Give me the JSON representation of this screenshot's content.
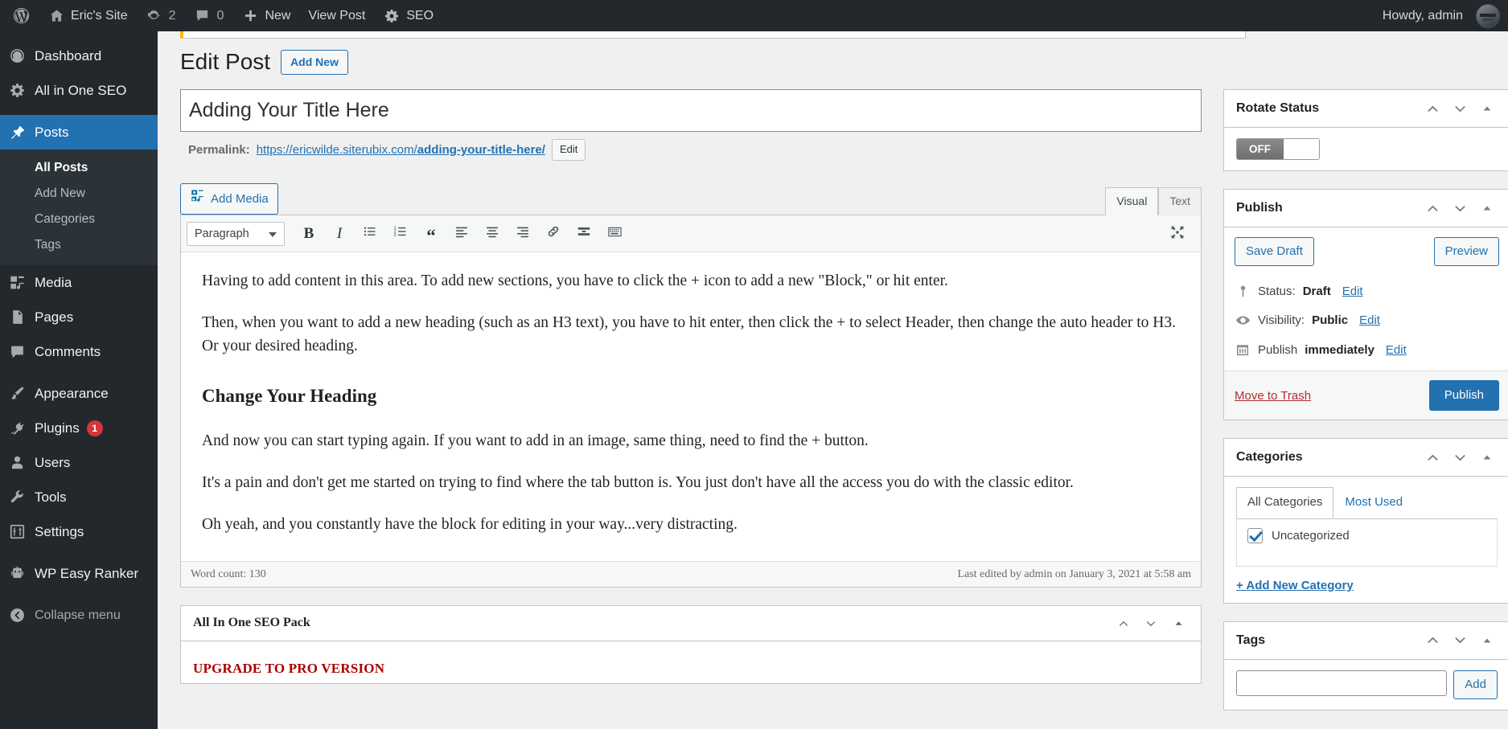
{
  "adminbar": {
    "wp_logo": "wordpress-logo-icon",
    "site_name": "Eric's Site",
    "updates_count": "2",
    "comments_count": "0",
    "new_label": "New",
    "view_post_label": "View Post",
    "seo_label": "SEO",
    "howdy": "Howdy, admin"
  },
  "sidebar": {
    "items": [
      {
        "label": "Dashboard",
        "icon": "dashboard-icon",
        "current": false
      },
      {
        "label": "All in One SEO",
        "icon": "aioseo-gear-icon",
        "current": false
      },
      {
        "label": "Posts",
        "icon": "pin-icon",
        "current": true
      },
      {
        "label": "Media",
        "icon": "media-icon",
        "current": false
      },
      {
        "label": "Pages",
        "icon": "pages-icon",
        "current": false
      },
      {
        "label": "Comments",
        "icon": "comment-icon",
        "current": false
      },
      {
        "label": "Appearance",
        "icon": "brush-icon",
        "current": false
      },
      {
        "label": "Plugins",
        "icon": "plug-icon",
        "current": false,
        "badge": "1"
      },
      {
        "label": "Users",
        "icon": "user-icon",
        "current": false
      },
      {
        "label": "Tools",
        "icon": "wrench-icon",
        "current": false
      },
      {
        "label": "Settings",
        "icon": "sliders-icon",
        "current": false
      },
      {
        "label": "WP Easy Ranker",
        "icon": "robot-icon",
        "current": false
      }
    ],
    "posts_submenu": [
      {
        "label": "All Posts",
        "current": true
      },
      {
        "label": "Add New",
        "current": false
      },
      {
        "label": "Categories",
        "current": false
      },
      {
        "label": "Tags",
        "current": false
      }
    ],
    "collapse_label": "Collapse menu",
    "collapse_icon": "collapse-arrow-icon"
  },
  "page": {
    "title": "Edit Post",
    "add_new_label": "Add New"
  },
  "title_field": {
    "value": "Adding Your Title Here",
    "placeholder": "Add title"
  },
  "permalink": {
    "label": "Permalink:",
    "url_prefix": "https://ericwilde.siterubix.com/",
    "slug": "adding-your-title-here/",
    "edit_label": "Edit"
  },
  "editor": {
    "add_media_label": "Add Media",
    "add_media_icon": "media-add-icon",
    "tabs": [
      {
        "label": "Visual",
        "active": true
      },
      {
        "label": "Text",
        "active": false
      }
    ],
    "format_select": "Paragraph",
    "toolbar_buttons": [
      {
        "name": "bold-icon",
        "label": "B"
      },
      {
        "name": "italic-icon",
        "label": "I"
      },
      {
        "name": "bulleted-list-icon",
        "label": ""
      },
      {
        "name": "numbered-list-icon",
        "label": ""
      },
      {
        "name": "blockquote-icon",
        "label": ""
      },
      {
        "name": "align-left-icon",
        "label": ""
      },
      {
        "name": "align-center-icon",
        "label": ""
      },
      {
        "name": "align-right-icon",
        "label": ""
      },
      {
        "name": "insert-link-icon",
        "label": ""
      },
      {
        "name": "read-more-icon",
        "label": ""
      },
      {
        "name": "toolbar-toggle-icon",
        "label": ""
      }
    ],
    "fullscreen_icon": "distraction-free-icon",
    "content": {
      "paragraph_1": "Having to add content in this area. To add new sections, you have to click the + icon to add a new \"Block,\" or hit enter.",
      "paragraph_2": "Then, when you want to add a new heading (such as an H3 text), you have to hit enter, then click the + to select Header, then change the auto header to H3. Or your desired heading.",
      "heading_1": "Change Your Heading",
      "paragraph_3": "And now you can start typing again. If you want to add in an image, same thing, need to find the + button.",
      "paragraph_4": "It's a pain and don't get me started on trying to find where the tab button is. You just don't have all the access you do with the classic editor.",
      "paragraph_5": "Oh yeah, and you constantly have the block for editing in your way...very distracting."
    },
    "word_count": "Word count: 130",
    "last_edited": "Last edited by admin on January 3, 2021 at 5:58 am"
  },
  "aioseo_box": {
    "title": "All In One SEO Pack",
    "upgrade_text": "UPGRADE TO PRO VERSION"
  },
  "rotate_status_box": {
    "title": "Rotate Status",
    "toggle_state": "OFF"
  },
  "publish_box": {
    "title": "Publish",
    "save_draft_label": "Save Draft",
    "preview_label": "Preview",
    "status_label": "Status:",
    "status_value": "Draft",
    "status_icon": "pin-status-icon",
    "status_edit": "Edit",
    "visibility_label": "Visibility:",
    "visibility_value": "Public",
    "visibility_icon": "eye-icon",
    "visibility_edit": "Edit",
    "schedule_label": "Publish",
    "schedule_value": "immediately",
    "schedule_icon": "calendar-icon",
    "schedule_edit": "Edit",
    "trash_label": "Move to Trash",
    "publish_label": "Publish"
  },
  "categories_box": {
    "title": "Categories",
    "tabs": [
      {
        "label": "All Categories",
        "active": true
      },
      {
        "label": "Most Used",
        "active": false
      }
    ],
    "items": [
      {
        "label": "Uncategorized",
        "checked": true
      }
    ],
    "add_new_label": "+ Add New Category"
  },
  "tags_box": {
    "title": "Tags",
    "input_value": "",
    "input_placeholder": "",
    "add_label": "Add"
  },
  "icons": {
    "move_up": "chevron-up-icon",
    "move_down": "chevron-down-icon",
    "toggle_panel": "triangle-up-icon"
  },
  "colors": {
    "admin_bar": "#23282d",
    "menu_bg": "#23282d",
    "accent_blue": "#2271b1",
    "current_menu": "#2271b1",
    "badge_red": "#d63638",
    "notice_orange": "#ffb900",
    "link_red": "#b32d2e",
    "aioseo_red": "#aa0000",
    "body_bg": "#f0f0f1"
  }
}
